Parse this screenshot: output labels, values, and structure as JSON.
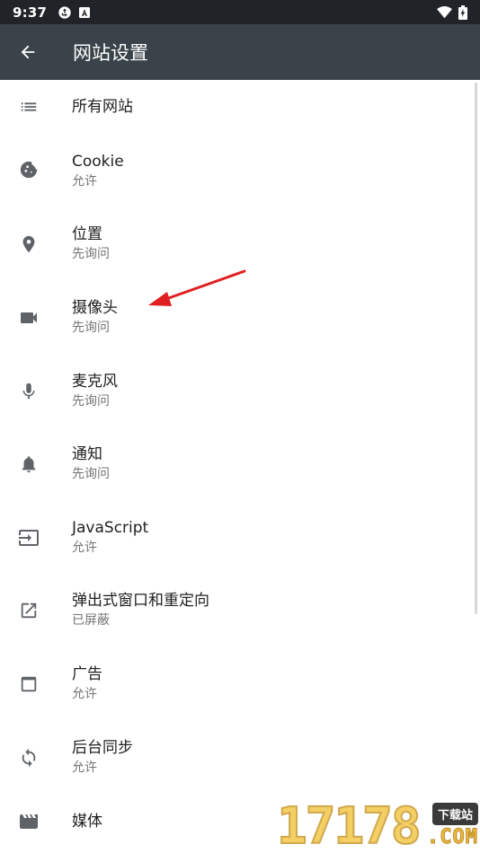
{
  "status_bar": {
    "time": "9:37",
    "icons": [
      "sync-icon",
      "a-badge-icon",
      "wifi-icon",
      "battery-charging-icon"
    ]
  },
  "app_bar": {
    "back_icon": "arrow-left-icon",
    "title": "网站设置"
  },
  "settings": [
    {
      "icon": "list-icon",
      "title": "所有网站",
      "subtitle": ""
    },
    {
      "icon": "cookie-icon",
      "title": "Cookie",
      "subtitle": "允许"
    },
    {
      "icon": "location-pin-icon",
      "title": "位置",
      "subtitle": "先询问"
    },
    {
      "icon": "videocam-icon",
      "title": "摄像头",
      "subtitle": "先询问"
    },
    {
      "icon": "mic-icon",
      "title": "麦克风",
      "subtitle": "先询问"
    },
    {
      "icon": "bell-icon",
      "title": "通知",
      "subtitle": "先询问"
    },
    {
      "icon": "input-arrow-icon",
      "title": "JavaScript",
      "subtitle": "允许"
    },
    {
      "icon": "open-in-new-icon",
      "title": "弹出式窗口和重定向",
      "subtitle": "已屏蔽"
    },
    {
      "icon": "window-icon",
      "title": "广告",
      "subtitle": "允许"
    },
    {
      "icon": "sync-arrows-icon",
      "title": "后台同步",
      "subtitle": "允许"
    },
    {
      "icon": "clapperboard-icon",
      "title": "媒体",
      "subtitle": ""
    }
  ],
  "annotation": {
    "color": "#e02020"
  },
  "watermark": {
    "digits": "17178",
    "tag": "下载站",
    "suffix": ".COM"
  },
  "colors": {
    "status_bar": "#202428",
    "app_bar": "#394349",
    "icon": "#5f6368",
    "title_text": "#202124",
    "subtitle_text": "#747474"
  }
}
